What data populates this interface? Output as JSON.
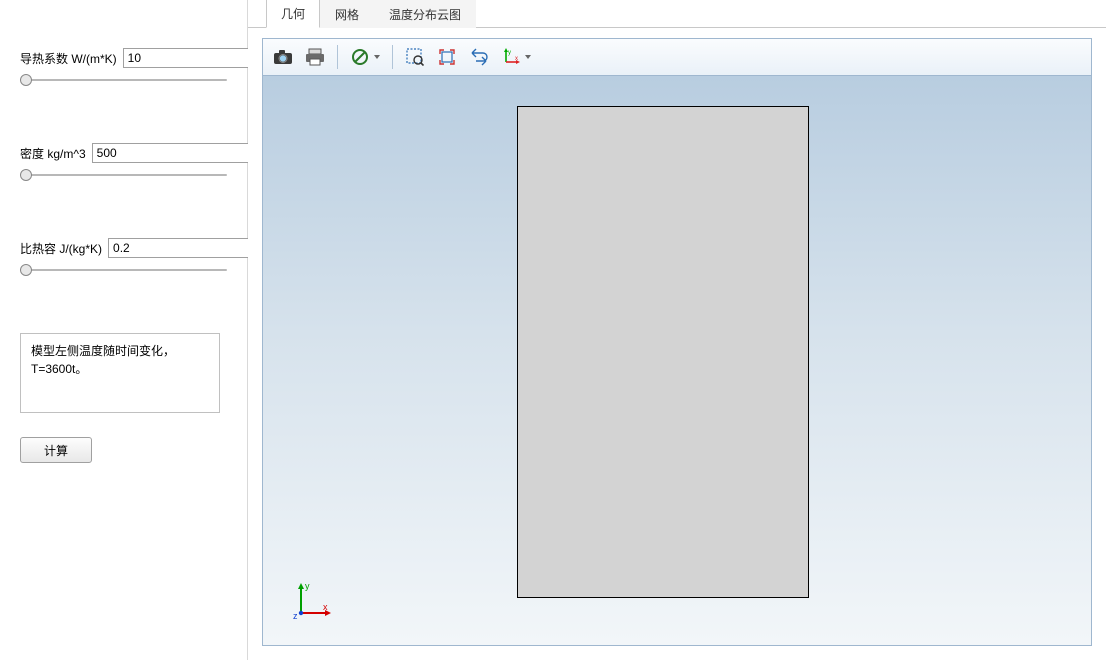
{
  "sidebar": {
    "params": [
      {
        "label": "导热系数 W/(m*K)",
        "value": "10"
      },
      {
        "label": "密度 kg/m^3",
        "value": "500"
      },
      {
        "label": "比热容 J/(kg*K)",
        "value": "0.2"
      }
    ],
    "description": "模型左侧温度随时间变化，T=3600t。",
    "compute_label": "计算"
  },
  "tabs": [
    {
      "label": "几何",
      "active": true
    },
    {
      "label": "网格",
      "active": false
    },
    {
      "label": "温度分布云图",
      "active": false
    }
  ],
  "toolbar": {
    "items": [
      {
        "name": "camera-icon"
      },
      {
        "name": "printer-icon"
      },
      {
        "sep": true
      },
      {
        "name": "no-symbol-icon",
        "dropdown": true
      },
      {
        "sep": true
      },
      {
        "name": "zoom-box-icon"
      },
      {
        "name": "zoom-extents-icon"
      },
      {
        "name": "rotate-icon"
      },
      {
        "name": "axes-icon",
        "dropdown": true
      }
    ]
  },
  "axes": {
    "x": "x",
    "y": "y",
    "z": "z"
  }
}
